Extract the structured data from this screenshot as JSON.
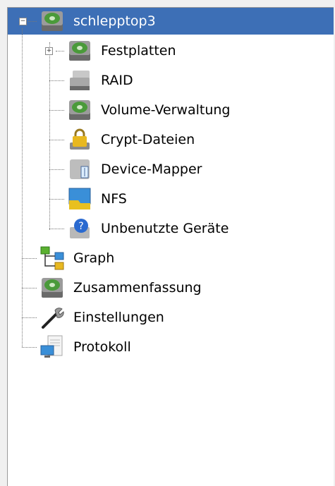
{
  "tree": {
    "root": {
      "label": "schlepptop3",
      "icon": "hard-disk-icon",
      "expanded": true,
      "selected": true
    },
    "children": [
      {
        "label": "Festplatten",
        "icon": "hard-disk-icon",
        "expandable": true
      },
      {
        "label": "RAID",
        "icon": "raid-disk-icon"
      },
      {
        "label": "Volume-Verwaltung",
        "icon": "volume-disk-icon"
      },
      {
        "label": "Crypt-Dateien",
        "icon": "lock-icon"
      },
      {
        "label": "Device-Mapper",
        "icon": "device-mapper-icon"
      },
      {
        "label": "NFS",
        "icon": "folder-network-icon"
      },
      {
        "label": "Unbenutzte Geräte",
        "icon": "unused-device-icon"
      }
    ],
    "top_level": [
      {
        "label": "Graph",
        "icon": "graph-icon"
      },
      {
        "label": "Zusammenfassung",
        "icon": "summary-disk-icon"
      },
      {
        "label": "Einstellungen",
        "icon": "wrench-icon"
      },
      {
        "label": "Protokoll",
        "icon": "log-document-icon"
      }
    ]
  },
  "colors": {
    "selection": "#3d6fb6",
    "tree_lines": "#777777"
  }
}
